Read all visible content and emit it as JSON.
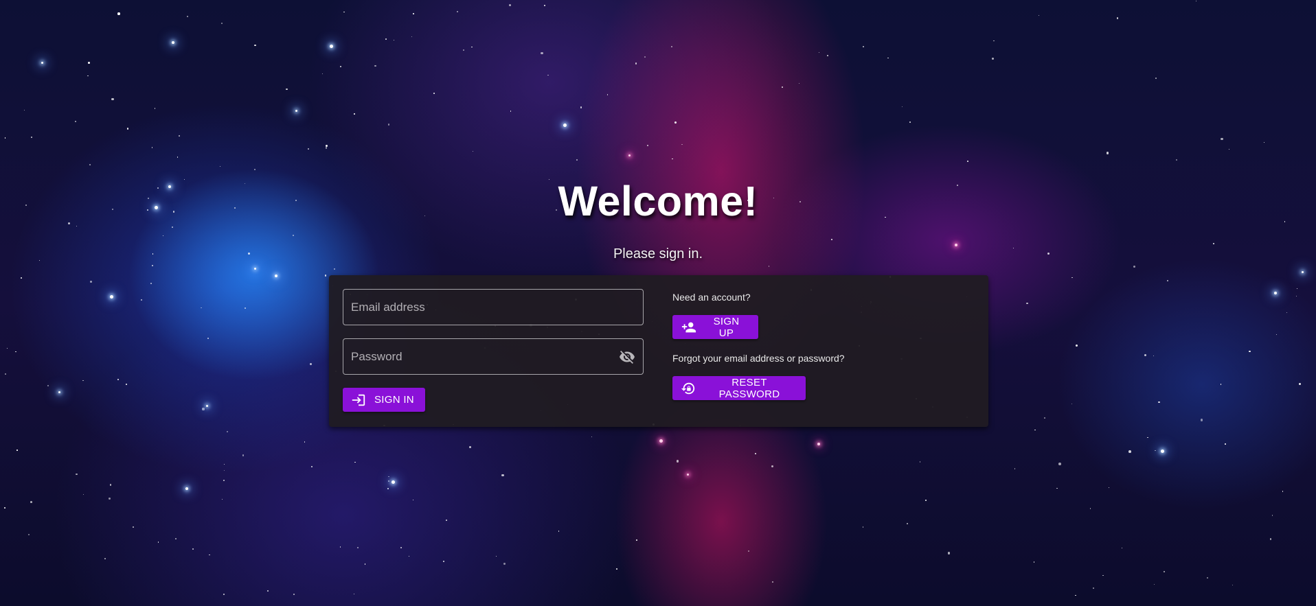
{
  "page": {
    "heading": "Welcome!",
    "subheading": "Please sign in."
  },
  "login": {
    "email_placeholder": "Email address",
    "email_value": "",
    "password_placeholder": "Password",
    "password_value": "",
    "password_toggle_icon": "eye-off-icon",
    "signin_label": "SIGN IN",
    "signin_icon": "login-icon"
  },
  "side": {
    "account_prompt": "Need an account?",
    "signup_label": "SIGN UP",
    "signup_icon": "person-add-icon",
    "forgot_prompt": "Forgot your email address or password?",
    "reset_label": "RESET PASSWORD",
    "reset_icon": "lock-reset-icon"
  },
  "colors": {
    "accent": "#8a11d8",
    "card_background": "#201c22",
    "text": "#ffffff"
  }
}
